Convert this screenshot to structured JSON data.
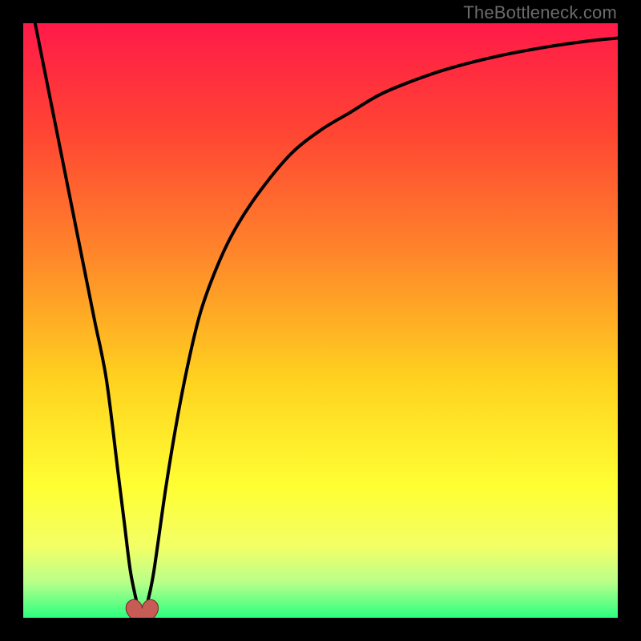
{
  "watermark": "TheBottleneck.com",
  "chart_data": {
    "type": "line",
    "title": "",
    "xlabel": "",
    "ylabel": "",
    "xlim": [
      0,
      100
    ],
    "ylim": [
      0,
      100
    ],
    "grid": false,
    "legend": false,
    "background_gradient": {
      "stops": [
        {
          "offset": 0.0,
          "color": "#ff1a49"
        },
        {
          "offset": 0.18,
          "color": "#ff4433"
        },
        {
          "offset": 0.4,
          "color": "#ff8a2a"
        },
        {
          "offset": 0.6,
          "color": "#ffd21f"
        },
        {
          "offset": 0.78,
          "color": "#ffff33"
        },
        {
          "offset": 0.88,
          "color": "#f3ff66"
        },
        {
          "offset": 0.94,
          "color": "#b9ff8a"
        },
        {
          "offset": 1.0,
          "color": "#2bff80"
        }
      ]
    },
    "series": [
      {
        "name": "bottleneck-curve",
        "color": "#000000",
        "x": [
          2,
          4,
          6,
          8,
          10,
          12,
          14,
          16,
          17,
          18,
          19,
          19.5,
          20,
          20.5,
          21,
          22,
          24,
          26,
          28,
          30,
          33,
          36,
          40,
          45,
          50,
          55,
          60,
          66,
          72,
          80,
          88,
          95,
          100
        ],
        "y": [
          100,
          90,
          80,
          70,
          60,
          50,
          40,
          24,
          16,
          8,
          3,
          1,
          0.5,
          1,
          3,
          8,
          22,
          34,
          44,
          52,
          60,
          66,
          72,
          78,
          82,
          85,
          88,
          90.5,
          92.5,
          94.5,
          96,
          97,
          97.5
        ]
      }
    ],
    "markers": [
      {
        "name": "heart-marker",
        "shape": "heart",
        "x": 20,
        "y": 0.5,
        "color": "#c75b55",
        "size": 28
      }
    ]
  }
}
